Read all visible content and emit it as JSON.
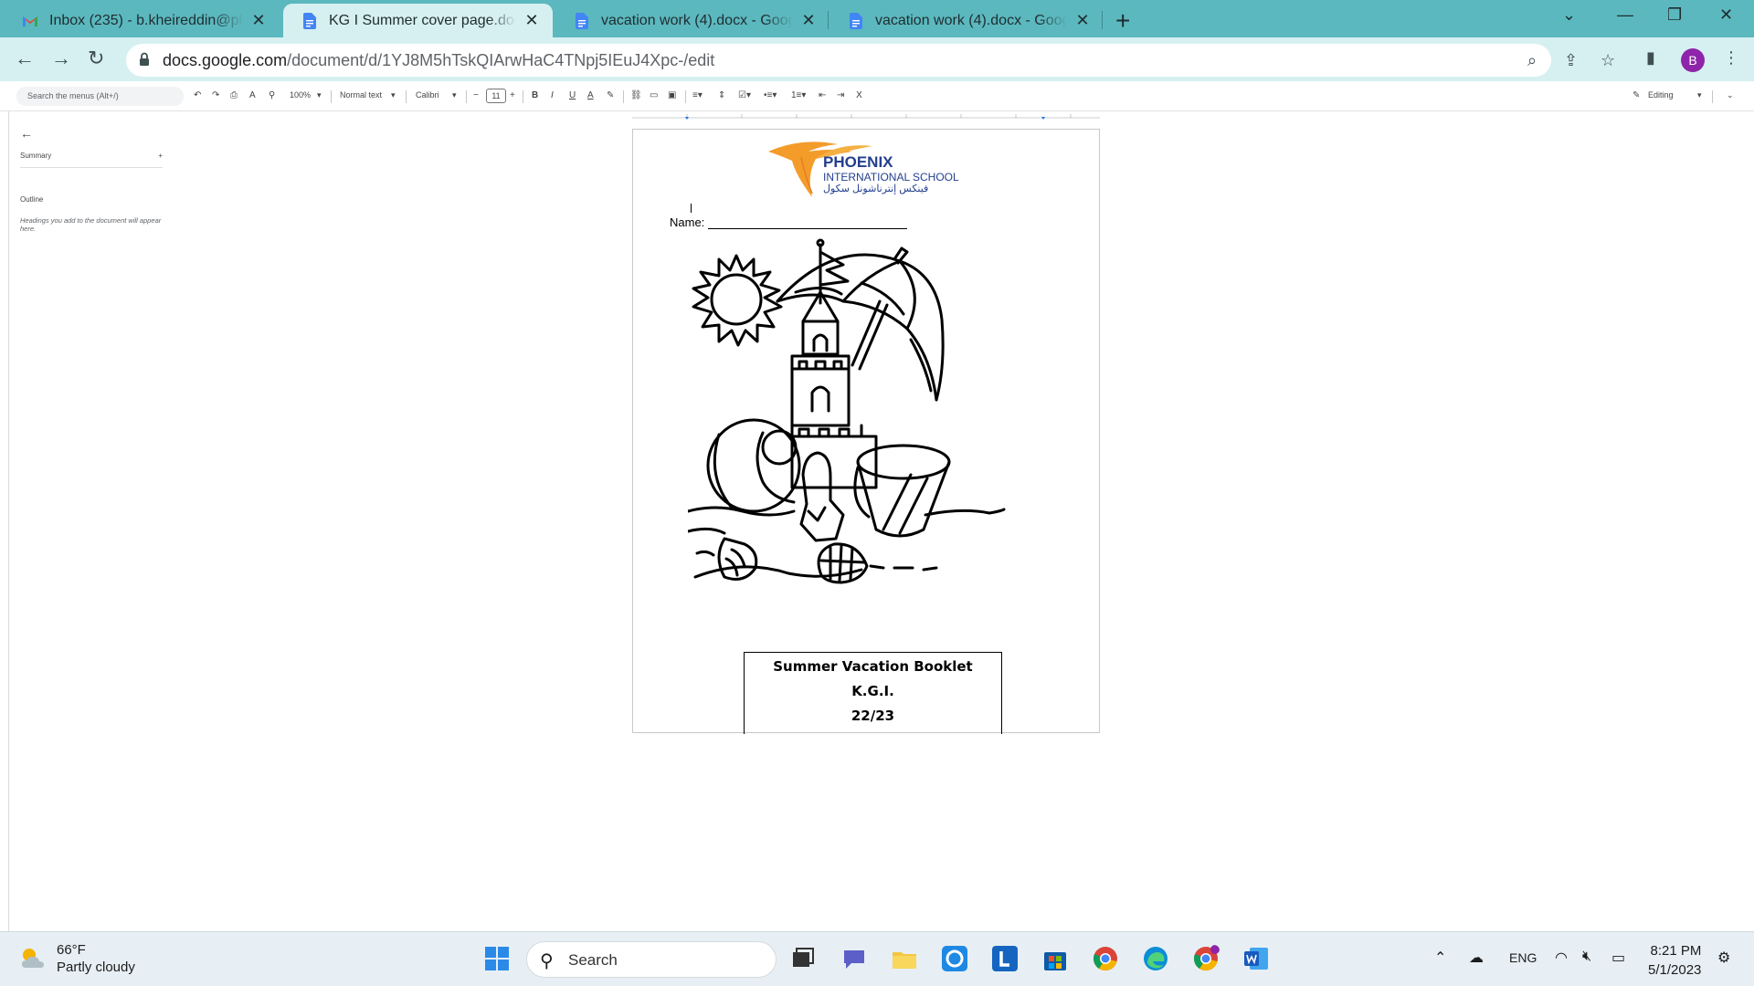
{
  "browser": {
    "tabs": [
      {
        "title": "Inbox (235) - b.kheireddin@phoe",
        "icon": "gmail-icon"
      },
      {
        "title": "KG I Summer cover page.docx - G",
        "icon": "docs-icon",
        "active": true
      },
      {
        "title": "vacation work (4).docx - Google D",
        "icon": "docs-icon"
      },
      {
        "title": "vacation work (4).docx - Google D",
        "icon": "docs-icon"
      }
    ],
    "url_host": "docs.google.com",
    "url_path": "/document/d/1YJ8M5hTskQIArwHaC4TNpj5IEuJ4Xpc-/edit",
    "profile_initial": "B"
  },
  "docs_toolbar": {
    "menu_search_placeholder": "Search the menus (Alt+/)",
    "zoom": "100%",
    "style": "Normal text",
    "font": "Calibri",
    "font_size": "11",
    "mode": "Editing"
  },
  "outline_panel": {
    "summary_label": "Summary",
    "outline_label": "Outline",
    "hint": "Headings you add to the document will appear here."
  },
  "document": {
    "school_name_line1": "PHOENIX",
    "school_name_line2": "INTERNATIONAL SCHOOL",
    "school_name_arabic": "فينكس إنترناشونل سكول",
    "name_label": "Name:",
    "title": "Summer Vacation Booklet",
    "class": "K.G.I.",
    "year": "22/23"
  },
  "taskbar": {
    "temperature": "66°F",
    "condition": "Partly cloudy",
    "search_label": "Search",
    "language": "ENG",
    "time": "8:21 PM",
    "date": "5/1/2023"
  }
}
